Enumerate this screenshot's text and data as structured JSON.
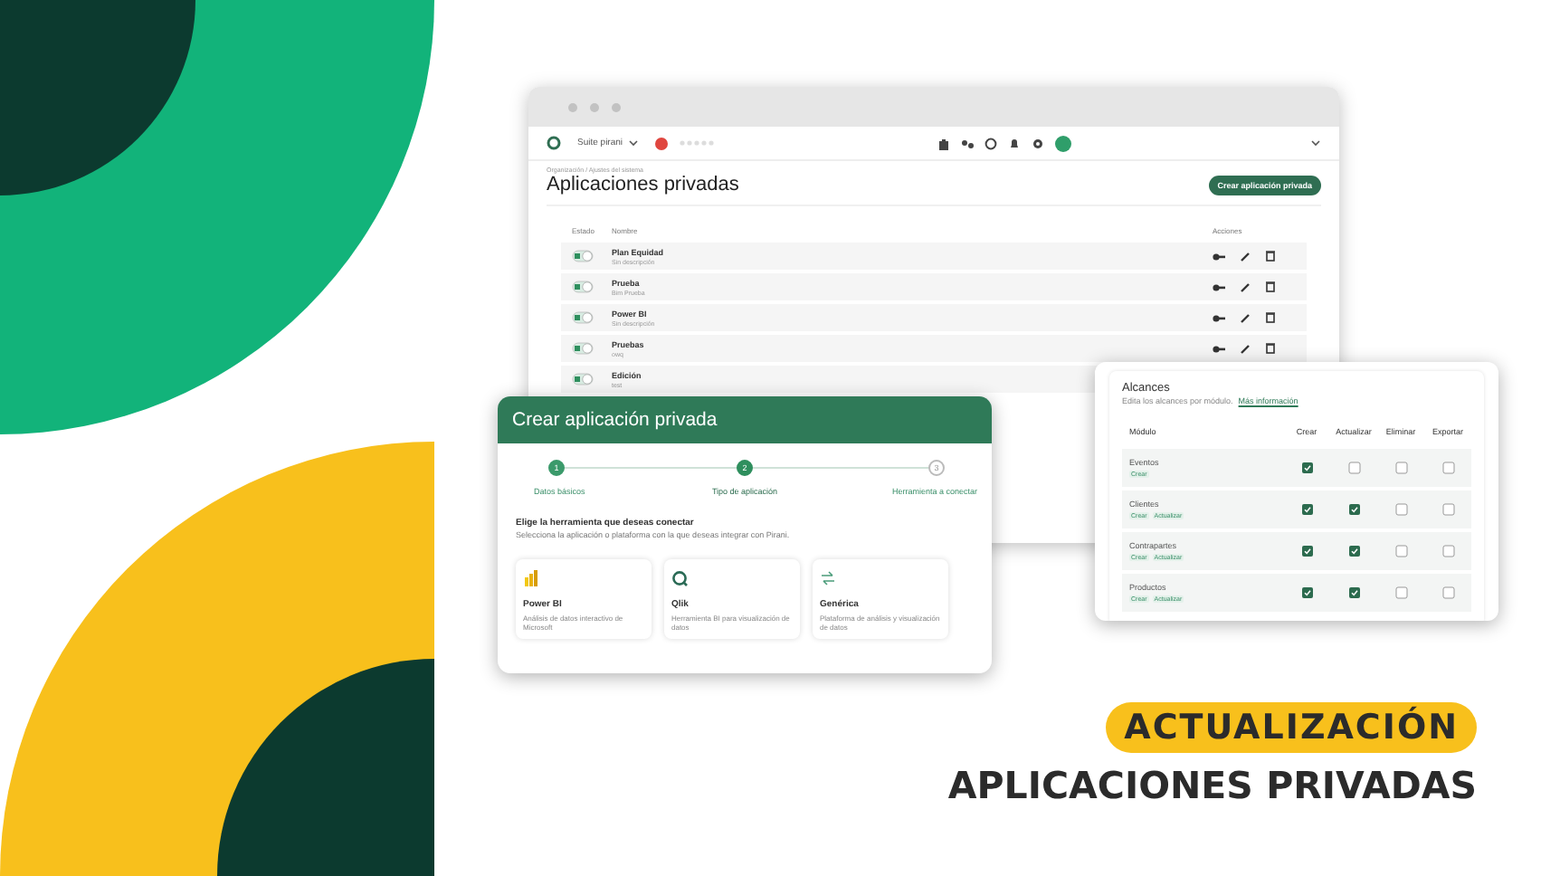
{
  "browser": {
    "app_menu": "Suite pirani",
    "breadcrumb": "Organización / Ajustes del sistema",
    "title": "Aplicaciones privadas",
    "create_button": "Crear aplicación privada",
    "columns": [
      "Estado",
      "Nombre",
      "Acciones"
    ],
    "rows": [
      {
        "name": "Plan Equidad",
        "description": "Sin descripción",
        "on": true
      },
      {
        "name": "Prueba",
        "description": "Bim Prueba",
        "on": true
      },
      {
        "name": "Power BI",
        "description": "Sin descripción",
        "on": true
      },
      {
        "name": "Pruebas",
        "description": "owq",
        "on": true
      },
      {
        "name": "Edición",
        "description": "test",
        "on": true
      }
    ]
  },
  "modal": {
    "title": "Crear aplicación privada",
    "steps": [
      {
        "number": "1",
        "label": "Datos básicos",
        "completed": true,
        "selected": false
      },
      {
        "number": "2",
        "label": "Tipo de aplicación",
        "completed": false,
        "selected": true
      },
      {
        "number": "3",
        "label": "Herramienta a conectar",
        "completed": false,
        "selected": false
      }
    ],
    "heading": "Elige la herramienta que deseas conectar",
    "subheading": "Selecciona la aplicación o plataforma con la que deseas integrar con Pirani.",
    "tools": [
      {
        "kind": "powerbi",
        "name": "Power BI",
        "description": "Análisis de datos interactivo de Microsoft"
      },
      {
        "kind": "qlik",
        "name": "Qlik",
        "description": "Herramienta BI para visualización de datos"
      },
      {
        "kind": "generic",
        "name": "Genérica",
        "description": "Plataforma de análisis y visualización de datos"
      }
    ]
  },
  "scopes": {
    "title": "Alcances",
    "subtitle": "Edita los alcances por módulo.",
    "link": "Más información",
    "columns": [
      "Módulo",
      "Crear",
      "Actualizar",
      "Eliminar",
      "Exportar"
    ],
    "rows": [
      {
        "module": "Eventos",
        "tags": [
          "Crear"
        ],
        "permissions": [
          {
            "checked": true
          },
          {
            "checked": false
          },
          {
            "checked": false
          },
          {
            "checked": false
          }
        ]
      },
      {
        "module": "Clientes",
        "tags": [
          "Crear",
          "Actualizar"
        ],
        "permissions": [
          {
            "checked": true
          },
          {
            "checked": true
          },
          {
            "checked": false
          },
          {
            "checked": false
          }
        ]
      },
      {
        "module": "Contrapartes",
        "tags": [
          "Crear",
          "Actualizar"
        ],
        "permissions": [
          {
            "checked": true
          },
          {
            "checked": true
          },
          {
            "checked": false
          },
          {
            "checked": false
          }
        ]
      },
      {
        "module": "Productos",
        "tags": [
          "Crear",
          "Actualizar"
        ],
        "permissions": [
          {
            "checked": true
          },
          {
            "checked": true
          },
          {
            "checked": false
          },
          {
            "checked": false
          }
        ]
      }
    ]
  },
  "banner": {
    "badge": "ACTUALIZACIÓN",
    "headline": "APLICACIONES PRIVADAS"
  }
}
